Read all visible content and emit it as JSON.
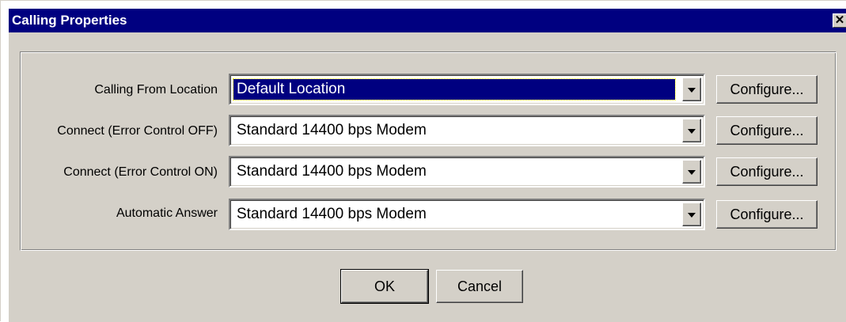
{
  "window": {
    "title": "Calling Properties",
    "close_glyph": "✕"
  },
  "rows": [
    {
      "label": "Calling From Location",
      "value": "Default Location",
      "configure": "Configure..."
    },
    {
      "label": "Connect (Error Control OFF)",
      "value": "Standard 14400 bps Modem",
      "configure": "Configure..."
    },
    {
      "label": "Connect (Error Control ON)",
      "value": "Standard 14400 bps Modem",
      "configure": "Configure..."
    },
    {
      "label": "Automatic Answer",
      "value": "Standard 14400 bps Modem",
      "configure": "Configure..."
    }
  ],
  "buttons": {
    "ok": "OK",
    "cancel": "Cancel"
  },
  "colors": {
    "titlebar": "#000080",
    "face": "#d4d0c8",
    "selection": "#000080"
  },
  "icons": {
    "close": "close-icon",
    "dropdown": "chevron-down-icon"
  }
}
